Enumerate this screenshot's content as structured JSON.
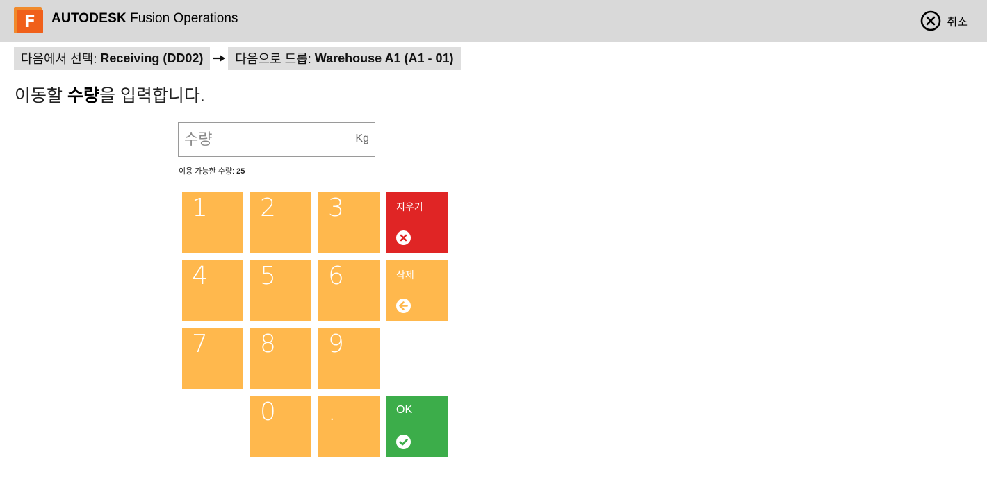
{
  "header": {
    "brand_bold": "AUTODESK",
    "brand_product": "Fusion Operations",
    "logo_letter": "F",
    "cancel_label": "취소",
    "colors": {
      "bar": "#d9d9d9",
      "logo": "#f0601a"
    }
  },
  "route": {
    "from_label": "다음에서 선택:",
    "from_value": "Receiving (DD02)",
    "to_label": "다음으로 드롭:",
    "to_value": "Warehouse A1 (A1 - 01)",
    "arrow_icon": "right-arrow-icon"
  },
  "prompt": {
    "before": "이동할",
    "emphasis": "수량",
    "after": "을 입력합니다."
  },
  "quantity": {
    "placeholder": "수량",
    "value": "",
    "unit": "Kg",
    "available_label": "이용 가능한 수량:",
    "available_value": "25"
  },
  "keypad": {
    "digits": [
      "1",
      "2",
      "3",
      "4",
      "5",
      "6",
      "7",
      "8",
      "9",
      "0",
      "."
    ],
    "clear_label": "지우기",
    "clear_icon": "x-circle-icon",
    "delete_label": "삭제",
    "delete_icon": "arrow-left-circle-icon",
    "ok_label": "OK",
    "ok_icon": "check-circle-icon",
    "colors": {
      "digit": "#ffb84d",
      "clear": "#e02525",
      "ok": "#3cad4a"
    }
  }
}
